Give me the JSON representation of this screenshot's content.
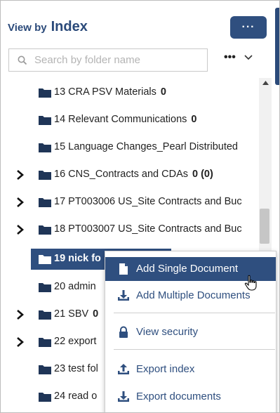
{
  "header": {
    "view_by": "View by",
    "index": "Index",
    "top_button": "···"
  },
  "search": {
    "placeholder": "Search by folder name"
  },
  "toolbar": {
    "more_label": "•••"
  },
  "tree": {
    "items": [
      {
        "label": "13 CRA PSV Materials",
        "count": "0",
        "expandable": false
      },
      {
        "label": "14 Relevant Communications",
        "count": "0",
        "expandable": false
      },
      {
        "label": "15 Language Changes_Pearl Distributed",
        "count": "",
        "expandable": false
      },
      {
        "label": "16 CNS_Contracts and CDAs",
        "count": "0 (0)",
        "expandable": true
      },
      {
        "label": "17 PT003006 US_Site Contracts and Buc",
        "count": "",
        "expandable": true
      },
      {
        "label": "18 PT003007 US_Site Contracts and Buc",
        "count": "",
        "expandable": true
      },
      {
        "label": "19 nick fo",
        "count": "",
        "expandable": false,
        "selected": true
      },
      {
        "label": "20 admin",
        "count": "",
        "expandable": false
      },
      {
        "label": "21 SBV",
        "count": "0",
        "expandable": true
      },
      {
        "label": "22 export",
        "count": "",
        "expandable": true
      },
      {
        "label": "23 test fol",
        "count": "",
        "expandable": false
      },
      {
        "label": "24 read o",
        "count": "",
        "expandable": false
      }
    ]
  },
  "context_menu": {
    "add_single": "Add Single Document",
    "add_multiple": "Add Multiple Documents",
    "view_security": "View security",
    "export_index": "Export index",
    "export_documents": "Export documents"
  },
  "colors": {
    "accent": "#2f4f7f",
    "text": "#222222",
    "placeholder": "#b4b4b4"
  }
}
